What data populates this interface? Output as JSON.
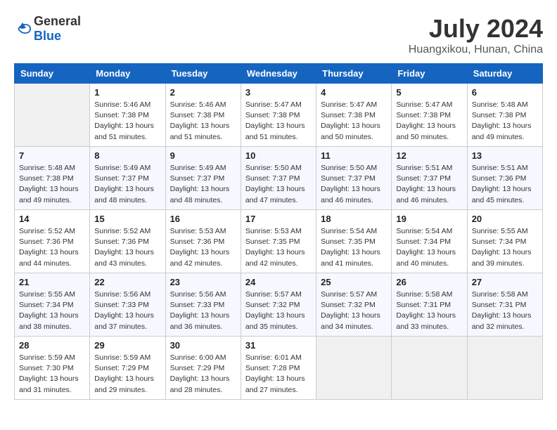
{
  "header": {
    "logo_general": "General",
    "logo_blue": "Blue",
    "month_year": "July 2024",
    "location": "Huangxikou, Hunan, China"
  },
  "days_of_week": [
    "Sunday",
    "Monday",
    "Tuesday",
    "Wednesday",
    "Thursday",
    "Friday",
    "Saturday"
  ],
  "weeks": [
    [
      {
        "day": "",
        "empty": true
      },
      {
        "day": "1",
        "sunrise": "5:46 AM",
        "sunset": "7:38 PM",
        "daylight": "13 hours and 51 minutes."
      },
      {
        "day": "2",
        "sunrise": "5:46 AM",
        "sunset": "7:38 PM",
        "daylight": "13 hours and 51 minutes."
      },
      {
        "day": "3",
        "sunrise": "5:47 AM",
        "sunset": "7:38 PM",
        "daylight": "13 hours and 51 minutes."
      },
      {
        "day": "4",
        "sunrise": "5:47 AM",
        "sunset": "7:38 PM",
        "daylight": "13 hours and 50 minutes."
      },
      {
        "day": "5",
        "sunrise": "5:47 AM",
        "sunset": "7:38 PM",
        "daylight": "13 hours and 50 minutes."
      },
      {
        "day": "6",
        "sunrise": "5:48 AM",
        "sunset": "7:38 PM",
        "daylight": "13 hours and 49 minutes."
      }
    ],
    [
      {
        "day": "7",
        "sunrise": "5:48 AM",
        "sunset": "7:38 PM",
        "daylight": "13 hours and 49 minutes."
      },
      {
        "day": "8",
        "sunrise": "5:49 AM",
        "sunset": "7:37 PM",
        "daylight": "13 hours and 48 minutes."
      },
      {
        "day": "9",
        "sunrise": "5:49 AM",
        "sunset": "7:37 PM",
        "daylight": "13 hours and 48 minutes."
      },
      {
        "day": "10",
        "sunrise": "5:50 AM",
        "sunset": "7:37 PM",
        "daylight": "13 hours and 47 minutes."
      },
      {
        "day": "11",
        "sunrise": "5:50 AM",
        "sunset": "7:37 PM",
        "daylight": "13 hours and 46 minutes."
      },
      {
        "day": "12",
        "sunrise": "5:51 AM",
        "sunset": "7:37 PM",
        "daylight": "13 hours and 46 minutes."
      },
      {
        "day": "13",
        "sunrise": "5:51 AM",
        "sunset": "7:36 PM",
        "daylight": "13 hours and 45 minutes."
      }
    ],
    [
      {
        "day": "14",
        "sunrise": "5:52 AM",
        "sunset": "7:36 PM",
        "daylight": "13 hours and 44 minutes."
      },
      {
        "day": "15",
        "sunrise": "5:52 AM",
        "sunset": "7:36 PM",
        "daylight": "13 hours and 43 minutes."
      },
      {
        "day": "16",
        "sunrise": "5:53 AM",
        "sunset": "7:36 PM",
        "daylight": "13 hours and 42 minutes."
      },
      {
        "day": "17",
        "sunrise": "5:53 AM",
        "sunset": "7:35 PM",
        "daylight": "13 hours and 42 minutes."
      },
      {
        "day": "18",
        "sunrise": "5:54 AM",
        "sunset": "7:35 PM",
        "daylight": "13 hours and 41 minutes."
      },
      {
        "day": "19",
        "sunrise": "5:54 AM",
        "sunset": "7:34 PM",
        "daylight": "13 hours and 40 minutes."
      },
      {
        "day": "20",
        "sunrise": "5:55 AM",
        "sunset": "7:34 PM",
        "daylight": "13 hours and 39 minutes."
      }
    ],
    [
      {
        "day": "21",
        "sunrise": "5:55 AM",
        "sunset": "7:34 PM",
        "daylight": "13 hours and 38 minutes."
      },
      {
        "day": "22",
        "sunrise": "5:56 AM",
        "sunset": "7:33 PM",
        "daylight": "13 hours and 37 minutes."
      },
      {
        "day": "23",
        "sunrise": "5:56 AM",
        "sunset": "7:33 PM",
        "daylight": "13 hours and 36 minutes."
      },
      {
        "day": "24",
        "sunrise": "5:57 AM",
        "sunset": "7:32 PM",
        "daylight": "13 hours and 35 minutes."
      },
      {
        "day": "25",
        "sunrise": "5:57 AM",
        "sunset": "7:32 PM",
        "daylight": "13 hours and 34 minutes."
      },
      {
        "day": "26",
        "sunrise": "5:58 AM",
        "sunset": "7:31 PM",
        "daylight": "13 hours and 33 minutes."
      },
      {
        "day": "27",
        "sunrise": "5:58 AM",
        "sunset": "7:31 PM",
        "daylight": "13 hours and 32 minutes."
      }
    ],
    [
      {
        "day": "28",
        "sunrise": "5:59 AM",
        "sunset": "7:30 PM",
        "daylight": "13 hours and 31 minutes."
      },
      {
        "day": "29",
        "sunrise": "5:59 AM",
        "sunset": "7:29 PM",
        "daylight": "13 hours and 29 minutes."
      },
      {
        "day": "30",
        "sunrise": "6:00 AM",
        "sunset": "7:29 PM",
        "daylight": "13 hours and 28 minutes."
      },
      {
        "day": "31",
        "sunrise": "6:01 AM",
        "sunset": "7:28 PM",
        "daylight": "13 hours and 27 minutes."
      },
      {
        "day": "",
        "empty": true
      },
      {
        "day": "",
        "empty": true
      },
      {
        "day": "",
        "empty": true
      }
    ]
  ]
}
